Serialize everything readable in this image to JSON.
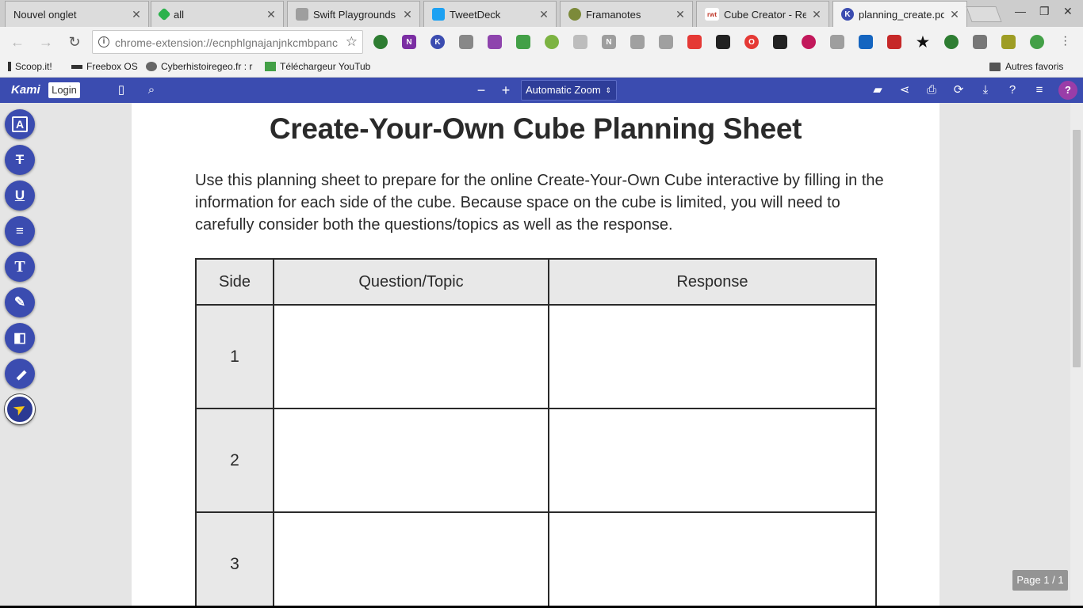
{
  "browser": {
    "tabs": [
      {
        "title": "Nouvel onglet",
        "icon": "blank-page-icon",
        "color": "#dcdcdc",
        "active": false
      },
      {
        "title": "all",
        "icon": "feedly-icon",
        "color": "#2bb24c",
        "active": false
      },
      {
        "title": "Swift Playgrounds d",
        "icon": "apple-icon",
        "color": "#9e9e9e",
        "active": false
      },
      {
        "title": "TweetDeck",
        "icon": "twitter-icon",
        "color": "#1da1f2",
        "active": false
      },
      {
        "title": "Framanotes",
        "icon": "framanotes-icon",
        "color": "#7c8a3a",
        "active": false
      },
      {
        "title": "Cube Creator - Read",
        "icon": "readwritethink-icon",
        "color": "#ffffff",
        "active": false
      },
      {
        "title": "planning_create.pdf",
        "icon": "kami-icon",
        "color": "#3b4cb0",
        "active": true
      }
    ],
    "url": "chrome-extension://ecnphlgnajanjnkcmbpanc",
    "bookmarks": [
      {
        "label": "Scoop.it!",
        "icon": "scoopit-icon"
      },
      {
        "label": "Freebox OS",
        "icon": "freebox-icon"
      },
      {
        "label": "Cyberhistoiregeo.fr : r",
        "icon": "wolf-icon"
      },
      {
        "label": "Téléchargeur YouTub",
        "icon": "download-arrow-icon"
      }
    ],
    "other_bookmarks": "Autres favoris"
  },
  "kami": {
    "logo": "Kami",
    "login_label": "Login",
    "zoom_label": "Automatic Zoom",
    "zoom_minus": "−",
    "zoom_plus": "+",
    "help_label": "?",
    "accent": "#3b4cb0",
    "page_indicator": "Page 1 / 1",
    "tools": [
      {
        "name": "text-select-tool",
        "glyph": "A"
      },
      {
        "name": "strikethrough-tool",
        "glyph": "S"
      },
      {
        "name": "underline-tool",
        "glyph": "U"
      },
      {
        "name": "comment-tool",
        "glyph": "≡"
      },
      {
        "name": "text-box-tool",
        "glyph": "T"
      },
      {
        "name": "drawing-tool",
        "glyph": "✎"
      },
      {
        "name": "shapes-tool",
        "glyph": "◧"
      },
      {
        "name": "eraser-tool",
        "glyph": "⌫"
      },
      {
        "name": "select-tool",
        "glyph": "➤"
      }
    ]
  },
  "document": {
    "title": "Create-Your-Own Cube Planning Sheet",
    "intro": "Use this planning sheet to prepare for the online Create-Your-Own Cube interactive by filling in the information for each side of the cube. Because space on the cube is limited, you will need to carefully consider both the questions/topics as well as the response.",
    "table": {
      "headers": [
        "Side",
        "Question/Topic",
        "Response"
      ],
      "rows": [
        {
          "side": "1",
          "question": "",
          "response": ""
        },
        {
          "side": "2",
          "question": "",
          "response": ""
        },
        {
          "side": "3",
          "question": "",
          "response": ""
        }
      ]
    }
  }
}
